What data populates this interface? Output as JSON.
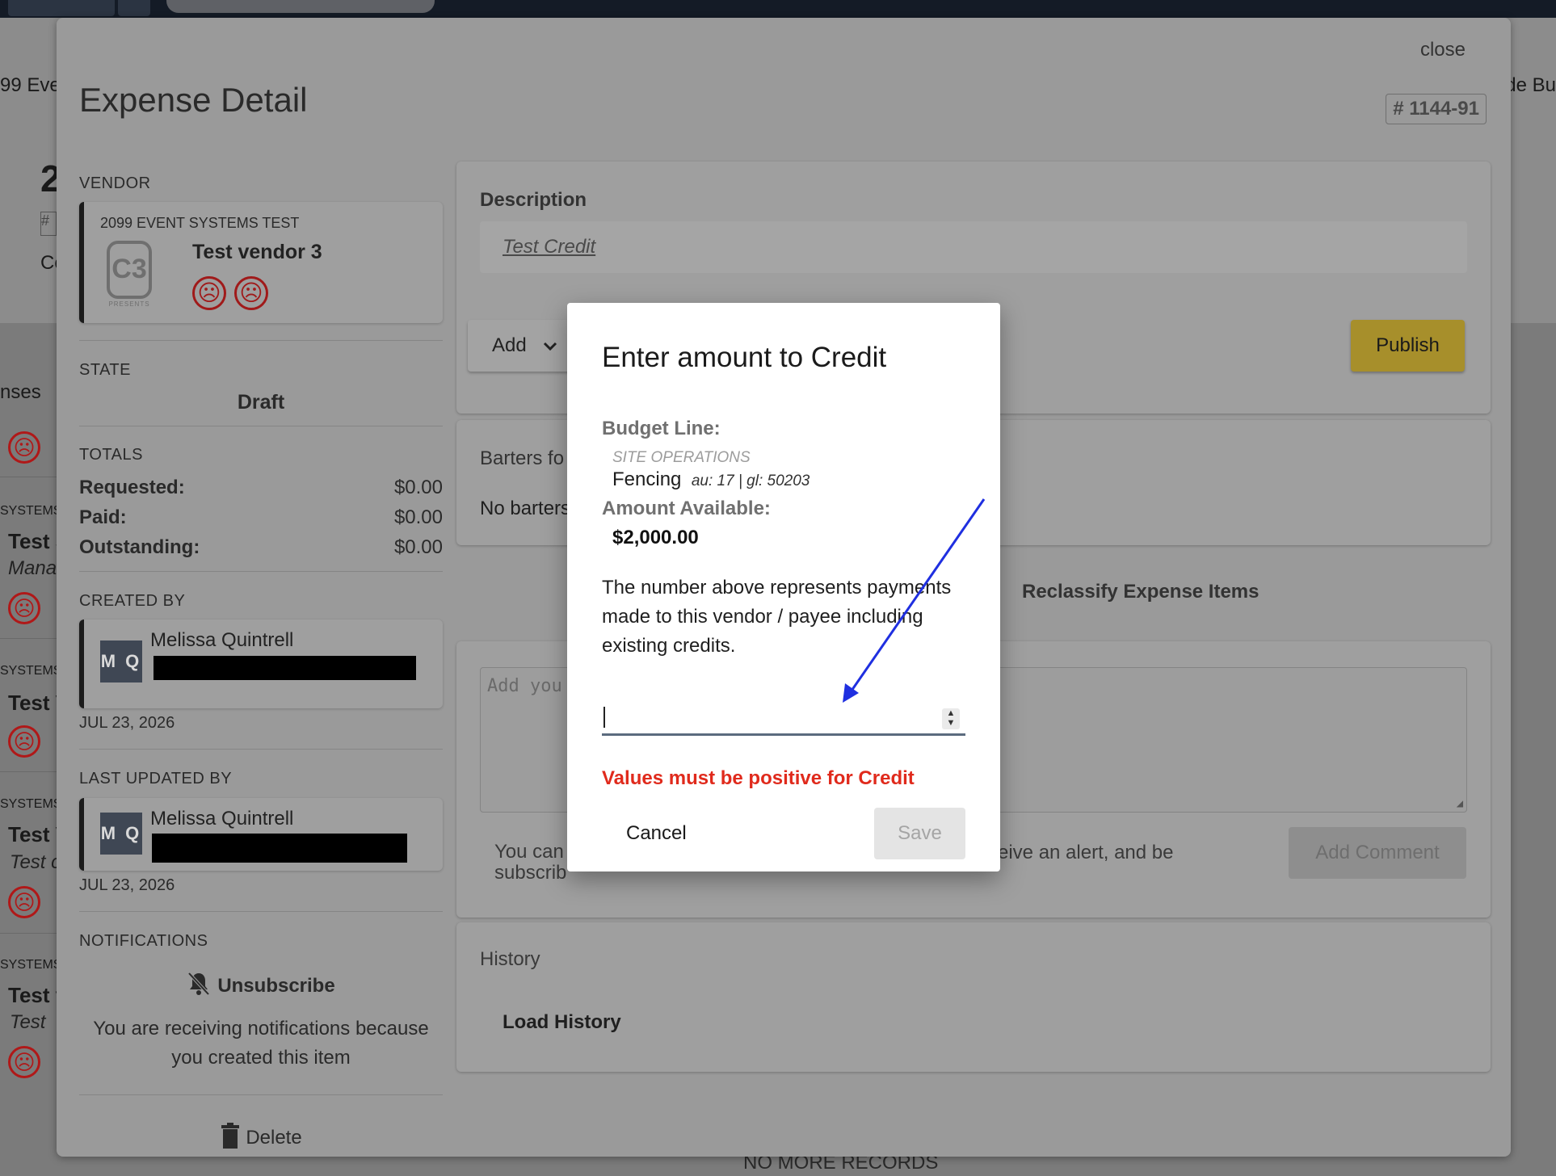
{
  "background": {
    "left_partial": [
      "99 Eve",
      "2",
      "#",
      "Co",
      "nses"
    ],
    "right_partial": "de Bu",
    "systems_label": "SYSTEMS",
    "rows": [
      {
        "title": "Test S",
        "sub": "Mana"
      },
      {
        "title": "Test V",
        "sub": ""
      },
      {
        "title": "Test V",
        "sub": "Test c"
      },
      {
        "title": "Test v",
        "sub": "Test"
      }
    ],
    "footer_partial": "NO MORE RECORDS"
  },
  "expense": {
    "close_label": "close",
    "title": "Expense Detail",
    "id": "# 1144-91",
    "vendor": {
      "label": "VENDOR",
      "org": "2099 EVENT SYSTEMS TEST",
      "name": "Test vendor 3",
      "logo_text": "C3",
      "logo_caption": "PRESENTS"
    },
    "state": {
      "label": "STATE",
      "value": "Draft"
    },
    "totals": {
      "label": "TOTALS",
      "rows": [
        {
          "label": "Requested:",
          "value": "$0.00"
        },
        {
          "label": "Paid:",
          "value": "$0.00"
        },
        {
          "label": "Outstanding:",
          "value": "$0.00"
        }
      ]
    },
    "created_by": {
      "label": "CREATED BY",
      "initials": "M Q",
      "name": "Melissa Quintrell",
      "date": "JUL 23, 2026"
    },
    "last_updated_by": {
      "label": "LAST UPDATED BY",
      "initials": "M Q",
      "name": "Melissa Quintrell",
      "date": "JUL 23, 2026"
    },
    "notifications": {
      "label": "NOTIFICATIONS",
      "unsubscribe": "Unsubscribe",
      "reason": "You are receiving notifications because you created this item"
    },
    "delete_label": "Delete",
    "description": {
      "label": "Description",
      "value": "Test Credit"
    },
    "add_label": "Add",
    "publish_label": "Publish",
    "barters": {
      "label_partial": "Barters fo",
      "empty_partial": "No barters"
    },
    "reclassify_label": "Reclassify Expense Items",
    "comment": {
      "placeholder_partial": "Add you",
      "hint_left": "You can",
      "hint_left2": "subscrib",
      "hint_right": "eive an alert, and be",
      "button": "Add Comment"
    },
    "history": {
      "label": "History",
      "load": "Load History"
    }
  },
  "dialog": {
    "title": "Enter amount to Credit",
    "budget_line_label": "Budget Line:",
    "budget_category": "SITE OPERATIONS",
    "budget_item": "Fencing",
    "budget_codes": "au: 17 | gl: 50203",
    "amount_available_label": "Amount Available:",
    "amount_available": "$2,000.00",
    "explanation": "The number above represents payments made to this vendor / payee including existing credits.",
    "input_value": "",
    "error": "Values must be positive for Credit",
    "cancel_label": "Cancel",
    "save_label": "Save"
  },
  "colors": {
    "publish": "#a78f2b",
    "error": "#e02a1c",
    "annotation_arrow": "#1f2fe0"
  }
}
